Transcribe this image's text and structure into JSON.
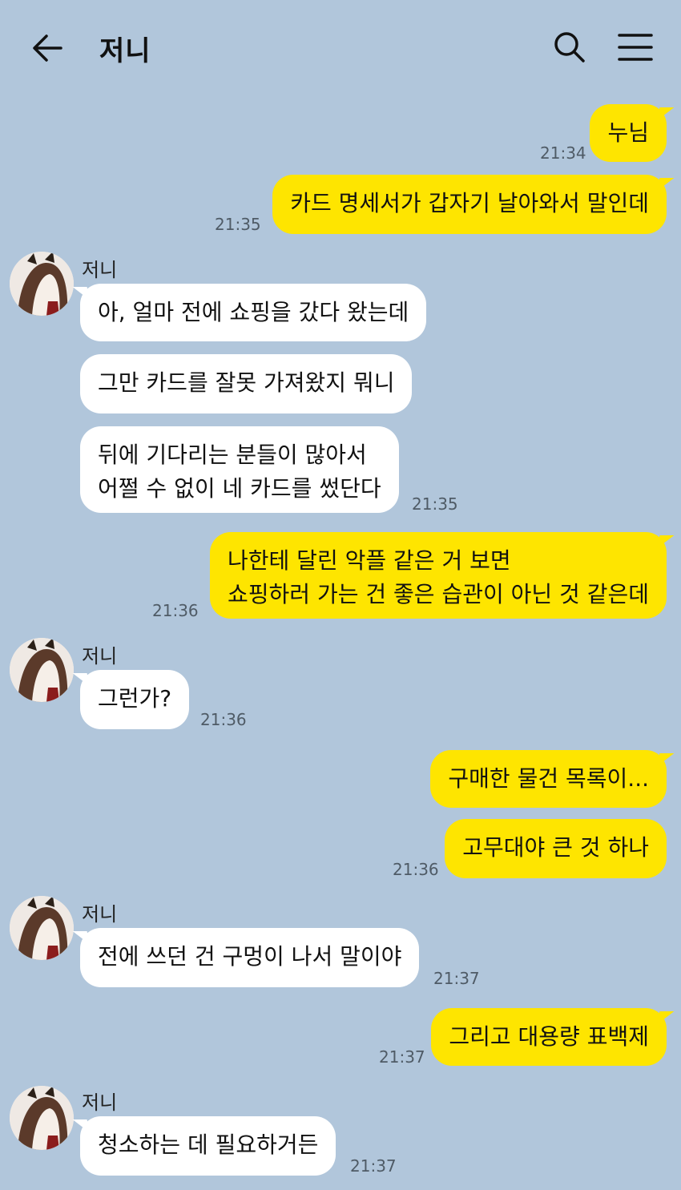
{
  "header": {
    "title": "저니",
    "back_icon": "arrow-left-icon",
    "search_icon": "search-icon",
    "menu_icon": "hamburger-menu-icon"
  },
  "colors": {
    "background": "#b1c6db",
    "my_bubble": "#fee500",
    "other_bubble": "#ffffff"
  },
  "messages": [
    {
      "from": "me",
      "text": "누님",
      "time": "21:34"
    },
    {
      "from": "me",
      "text": "카드 명세서가 갑자기 날아와서 말인데",
      "time": "21:35"
    },
    {
      "from": "other",
      "sender": "저니",
      "text": "아, 얼마 전에 쇼핑을 갔다 왔는데"
    },
    {
      "from": "other",
      "text": "그만 카드를 잘못 가져왔지 뭐니"
    },
    {
      "from": "other",
      "lines": [
        "뒤에 기다리는 분들이 많아서",
        "어쩔 수 없이 네 카드를 썼단다"
      ],
      "time": "21:35"
    },
    {
      "from": "me",
      "lines": [
        "나한테 달린 악플 같은 거 보면",
        "쇼핑하러 가는 건 좋은 습관이 아닌 것 같은데"
      ],
      "time": "21:36"
    },
    {
      "from": "other",
      "sender": "저니",
      "text": "그런가?",
      "time": "21:36"
    },
    {
      "from": "me",
      "text": "구매한 물건 목록이..."
    },
    {
      "from": "me",
      "text": "고무대야 큰 것 하나",
      "time": "21:36"
    },
    {
      "from": "other",
      "sender": "저니",
      "text": "전에 쓰던 건 구멍이 나서 말이야",
      "time": "21:37"
    },
    {
      "from": "me",
      "text": "그리고 대용량 표백제",
      "time": "21:37"
    },
    {
      "from": "other",
      "sender": "저니",
      "text": "청소하는 데 필요하거든",
      "time": "21:37"
    }
  ]
}
